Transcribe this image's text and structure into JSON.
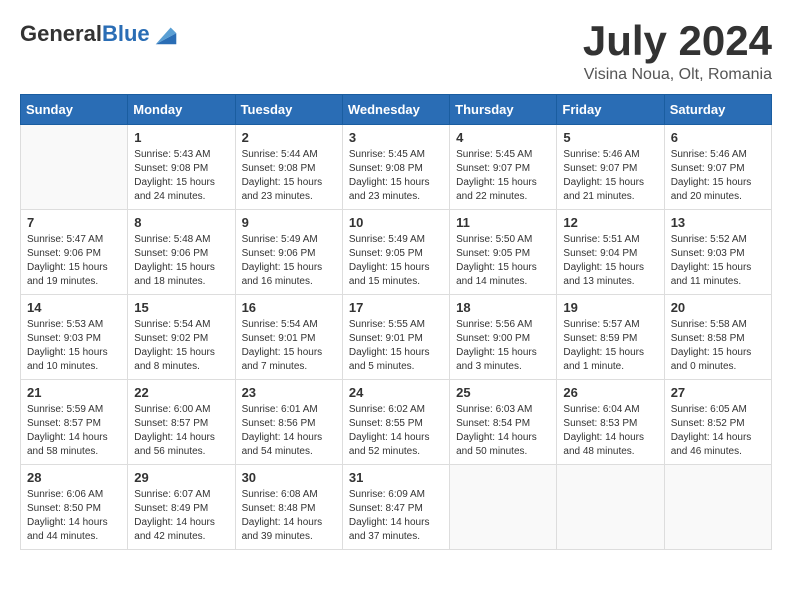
{
  "logo": {
    "general": "General",
    "blue": "Blue"
  },
  "title": "July 2024",
  "location": "Visina Noua, Olt, Romania",
  "days_of_week": [
    "Sunday",
    "Monday",
    "Tuesday",
    "Wednesday",
    "Thursday",
    "Friday",
    "Saturday"
  ],
  "weeks": [
    [
      {
        "day": "",
        "info": ""
      },
      {
        "day": "1",
        "info": "Sunrise: 5:43 AM\nSunset: 9:08 PM\nDaylight: 15 hours\nand 24 minutes."
      },
      {
        "day": "2",
        "info": "Sunrise: 5:44 AM\nSunset: 9:08 PM\nDaylight: 15 hours\nand 23 minutes."
      },
      {
        "day": "3",
        "info": "Sunrise: 5:45 AM\nSunset: 9:08 PM\nDaylight: 15 hours\nand 23 minutes."
      },
      {
        "day": "4",
        "info": "Sunrise: 5:45 AM\nSunset: 9:07 PM\nDaylight: 15 hours\nand 22 minutes."
      },
      {
        "day": "5",
        "info": "Sunrise: 5:46 AM\nSunset: 9:07 PM\nDaylight: 15 hours\nand 21 minutes."
      },
      {
        "day": "6",
        "info": "Sunrise: 5:46 AM\nSunset: 9:07 PM\nDaylight: 15 hours\nand 20 minutes."
      }
    ],
    [
      {
        "day": "7",
        "info": "Sunrise: 5:47 AM\nSunset: 9:06 PM\nDaylight: 15 hours\nand 19 minutes."
      },
      {
        "day": "8",
        "info": "Sunrise: 5:48 AM\nSunset: 9:06 PM\nDaylight: 15 hours\nand 18 minutes."
      },
      {
        "day": "9",
        "info": "Sunrise: 5:49 AM\nSunset: 9:06 PM\nDaylight: 15 hours\nand 16 minutes."
      },
      {
        "day": "10",
        "info": "Sunrise: 5:49 AM\nSunset: 9:05 PM\nDaylight: 15 hours\nand 15 minutes."
      },
      {
        "day": "11",
        "info": "Sunrise: 5:50 AM\nSunset: 9:05 PM\nDaylight: 15 hours\nand 14 minutes."
      },
      {
        "day": "12",
        "info": "Sunrise: 5:51 AM\nSunset: 9:04 PM\nDaylight: 15 hours\nand 13 minutes."
      },
      {
        "day": "13",
        "info": "Sunrise: 5:52 AM\nSunset: 9:03 PM\nDaylight: 15 hours\nand 11 minutes."
      }
    ],
    [
      {
        "day": "14",
        "info": "Sunrise: 5:53 AM\nSunset: 9:03 PM\nDaylight: 15 hours\nand 10 minutes."
      },
      {
        "day": "15",
        "info": "Sunrise: 5:54 AM\nSunset: 9:02 PM\nDaylight: 15 hours\nand 8 minutes."
      },
      {
        "day": "16",
        "info": "Sunrise: 5:54 AM\nSunset: 9:01 PM\nDaylight: 15 hours\nand 7 minutes."
      },
      {
        "day": "17",
        "info": "Sunrise: 5:55 AM\nSunset: 9:01 PM\nDaylight: 15 hours\nand 5 minutes."
      },
      {
        "day": "18",
        "info": "Sunrise: 5:56 AM\nSunset: 9:00 PM\nDaylight: 15 hours\nand 3 minutes."
      },
      {
        "day": "19",
        "info": "Sunrise: 5:57 AM\nSunset: 8:59 PM\nDaylight: 15 hours\nand 1 minute."
      },
      {
        "day": "20",
        "info": "Sunrise: 5:58 AM\nSunset: 8:58 PM\nDaylight: 15 hours\nand 0 minutes."
      }
    ],
    [
      {
        "day": "21",
        "info": "Sunrise: 5:59 AM\nSunset: 8:57 PM\nDaylight: 14 hours\nand 58 minutes."
      },
      {
        "day": "22",
        "info": "Sunrise: 6:00 AM\nSunset: 8:57 PM\nDaylight: 14 hours\nand 56 minutes."
      },
      {
        "day": "23",
        "info": "Sunrise: 6:01 AM\nSunset: 8:56 PM\nDaylight: 14 hours\nand 54 minutes."
      },
      {
        "day": "24",
        "info": "Sunrise: 6:02 AM\nSunset: 8:55 PM\nDaylight: 14 hours\nand 52 minutes."
      },
      {
        "day": "25",
        "info": "Sunrise: 6:03 AM\nSunset: 8:54 PM\nDaylight: 14 hours\nand 50 minutes."
      },
      {
        "day": "26",
        "info": "Sunrise: 6:04 AM\nSunset: 8:53 PM\nDaylight: 14 hours\nand 48 minutes."
      },
      {
        "day": "27",
        "info": "Sunrise: 6:05 AM\nSunset: 8:52 PM\nDaylight: 14 hours\nand 46 minutes."
      }
    ],
    [
      {
        "day": "28",
        "info": "Sunrise: 6:06 AM\nSunset: 8:50 PM\nDaylight: 14 hours\nand 44 minutes."
      },
      {
        "day": "29",
        "info": "Sunrise: 6:07 AM\nSunset: 8:49 PM\nDaylight: 14 hours\nand 42 minutes."
      },
      {
        "day": "30",
        "info": "Sunrise: 6:08 AM\nSunset: 8:48 PM\nDaylight: 14 hours\nand 39 minutes."
      },
      {
        "day": "31",
        "info": "Sunrise: 6:09 AM\nSunset: 8:47 PM\nDaylight: 14 hours\nand 37 minutes."
      },
      {
        "day": "",
        "info": ""
      },
      {
        "day": "",
        "info": ""
      },
      {
        "day": "",
        "info": ""
      }
    ]
  ]
}
